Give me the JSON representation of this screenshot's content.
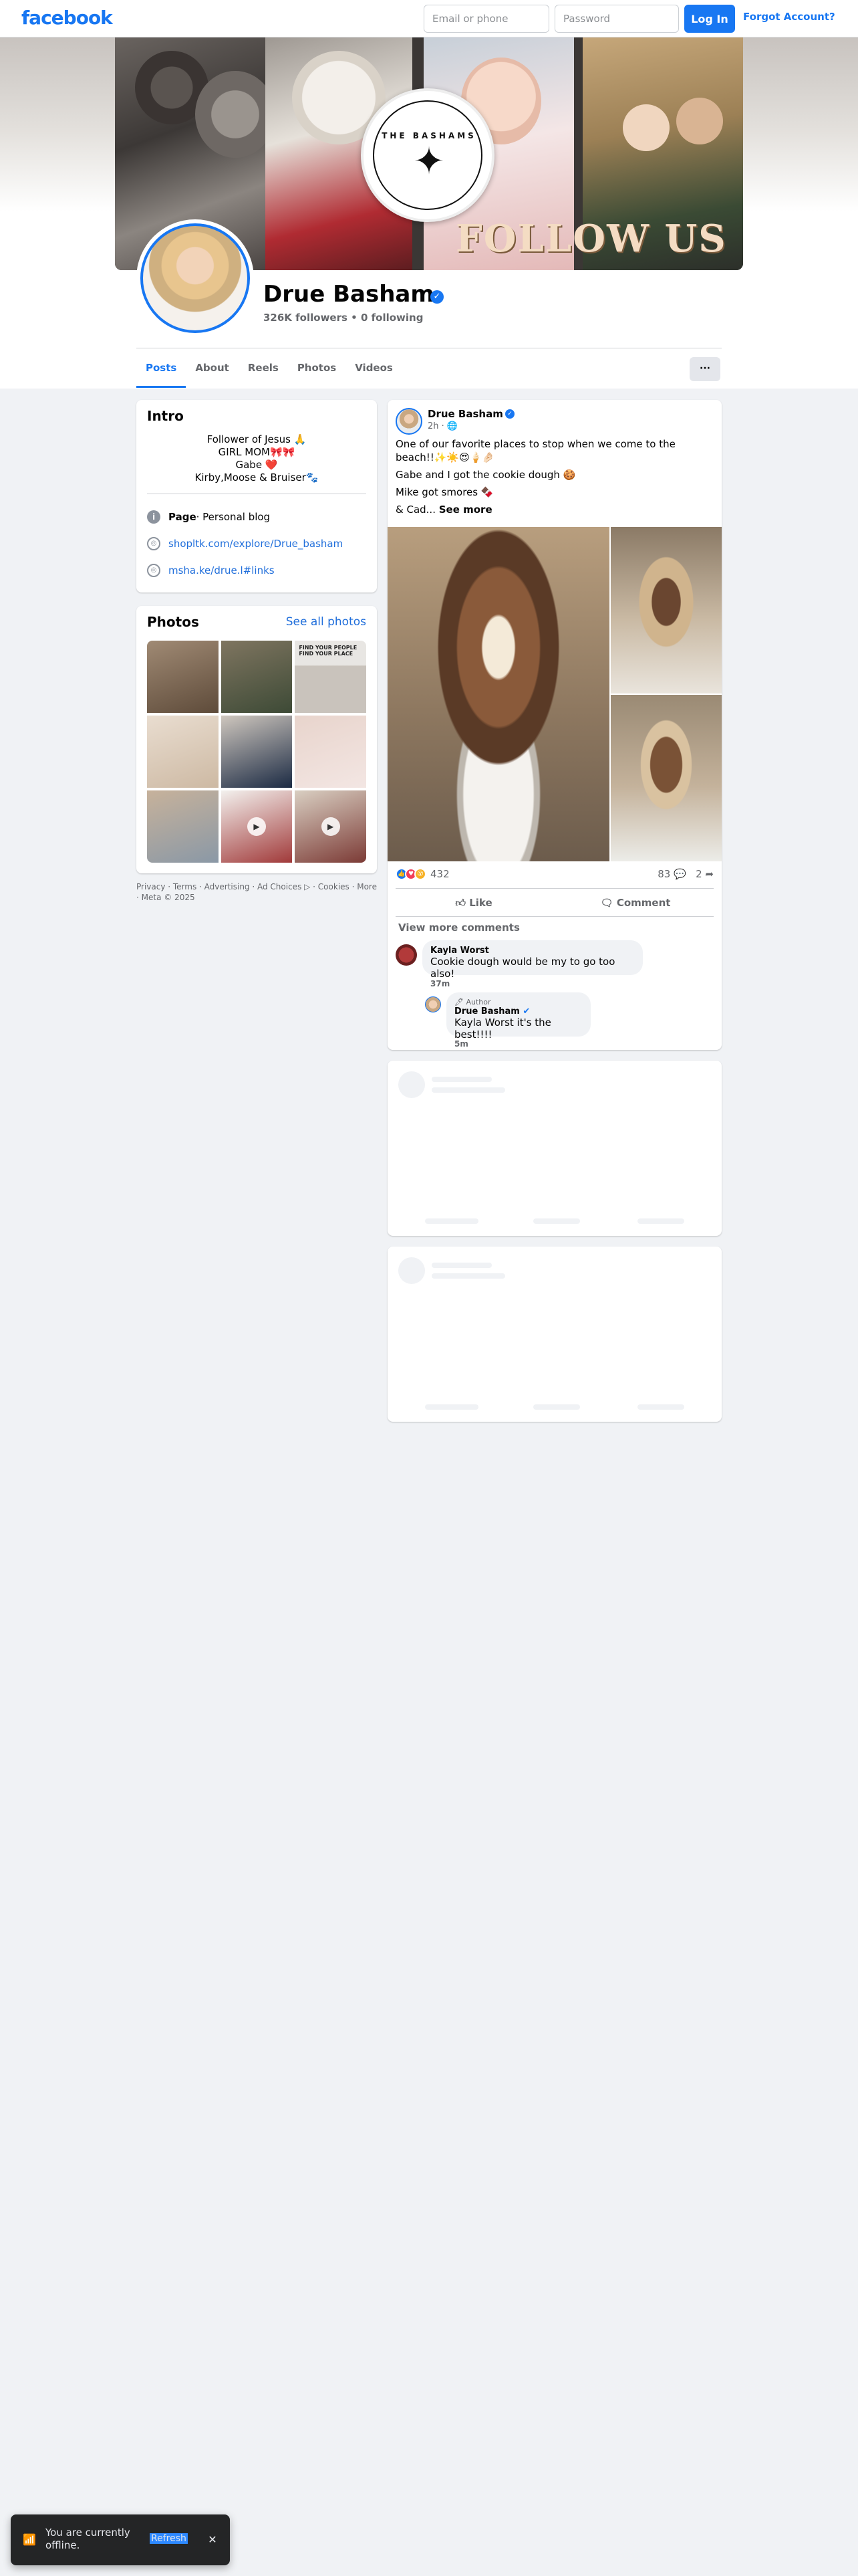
{
  "topbar": {
    "logo": "facebook",
    "email_placeholder": "Email or phone",
    "password_placeholder": "Password",
    "login_label": "Log In",
    "forgot_label": "Forgot Account?"
  },
  "cover": {
    "logo_text": "THE BASHAMS",
    "logo_star": "✦",
    "follow_text": "FOLLOW US"
  },
  "profile": {
    "name": "Drue Basham",
    "verified_icon": "✓",
    "stats": "326K followers • 0 following"
  },
  "tabs": [
    "Posts",
    "About",
    "Reels",
    "Photos",
    "Videos"
  ],
  "more_label": "···",
  "intro": {
    "title": "Intro",
    "bio": [
      "Follower of Jesus 🙏",
      "GIRL MOM🎀🎀",
      "Gabe ❤️",
      "Kirby,Moose & Bruiser🐾"
    ],
    "category_bold": "Page",
    "category_rest": " · Personal blog",
    "link1": "shopltk.com/explore/Drue_basham",
    "link2": "msha.ke/drue.l#links"
  },
  "photos": {
    "title": "Photos",
    "see_all": "See all photos",
    "grid_text": "FIND YOUR PEOPLE FIND YOUR PLACE"
  },
  "footer": {
    "line": "Privacy · Terms · Advertising · Ad Choices ▷ · Cookies · More · Meta © 2025"
  },
  "post": {
    "author": "Drue Basham",
    "time": "2h · 🌐",
    "lines": [
      "One of our favorite places to stop when we come to the beach!!✨☀️😍🍦🤌🏻",
      "Gabe and I got the cookie dough 🍪",
      "Mike got smores 🍫",
      "& Cad..."
    ],
    "see_more": "See more",
    "reactions_count": "432",
    "comments_count": "83 💬",
    "shares_count": "2 ➦",
    "like_label": "Like",
    "comment_label": "Comment",
    "view_more_comments": "View more comments",
    "comment1": {
      "name": "Kayla Worst",
      "text": "Cookie dough would be my to go too also!",
      "time": "37m"
    },
    "comment2": {
      "tag": "🖊 Author",
      "name": "Drue Basham",
      "text": "Kayla Worst it's the best!!!!",
      "time": "5m"
    }
  },
  "toast": {
    "text": "You are currently offline.",
    "refresh": "Refresh",
    "close": "✕"
  }
}
